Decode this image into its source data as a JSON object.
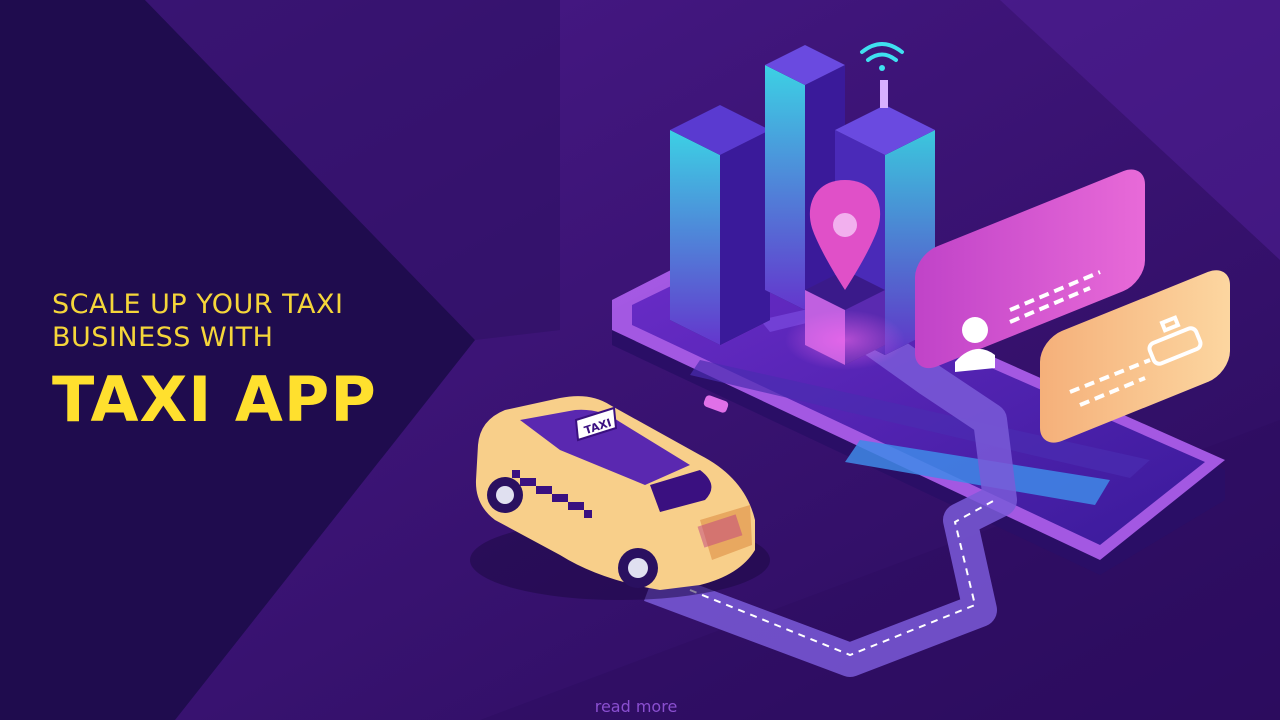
{
  "headline": {
    "line1": "SCALE UP YOUR TAXI",
    "line2": "BUSINESS WITH",
    "title": "TAXI APP"
  },
  "car": {
    "sign": "TAXI"
  },
  "footer": {
    "link_label": "read more"
  },
  "colors": {
    "background": "#3a1470",
    "left_panel": "#1f0c4e",
    "headline": "#f5d63a",
    "accent_cyan": "#3fe0f0",
    "accent_pink": "#e050c8",
    "taxi_body": "#f8cf8a"
  }
}
